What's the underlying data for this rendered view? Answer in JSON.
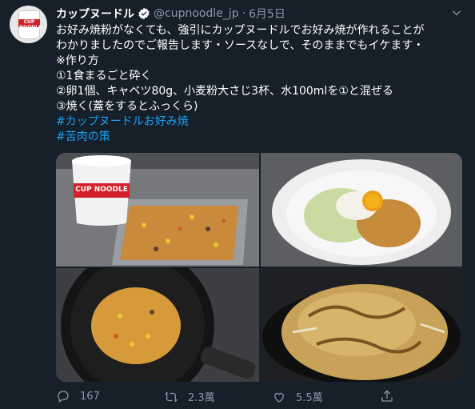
{
  "author": {
    "name": "カップヌードル",
    "handle": "@cupnoodle_jp",
    "separator": "·",
    "date": "6月5日",
    "avatar_text": "CUP NOODLE"
  },
  "body": {
    "lines": [
      "お好み焼粉がなくても、強引にカップヌードルでお好み焼が作れることが",
      "わかりましたのでご報告します・ソースなしで、そのままでもイケます・",
      "※作り方",
      "①1食まるごと砕く",
      "②卵1個、キャベツ80g、小麦粉大さじ3杯、水100mlを①と混ぜる",
      "③焼く(蓋をするとふっくら)"
    ],
    "hashtags": [
      "#カップヌードルお好み焼",
      "#苦肉の策"
    ]
  },
  "photos": {
    "photo1_cup_text": "CUP NOODLE"
  },
  "actions": {
    "reply_count": "167",
    "retweet_count": "2.3萬",
    "like_count": "5.5萬"
  },
  "colors": {
    "background": "#15202b",
    "text": "#ffffff",
    "secondary": "#8899a6",
    "link": "#1da1f2"
  },
  "icons": {
    "verified": "verified-badge-icon",
    "caret": "chevron-down-icon",
    "reply": "reply-icon",
    "retweet": "retweet-icon",
    "like": "heart-icon",
    "share": "share-icon"
  }
}
